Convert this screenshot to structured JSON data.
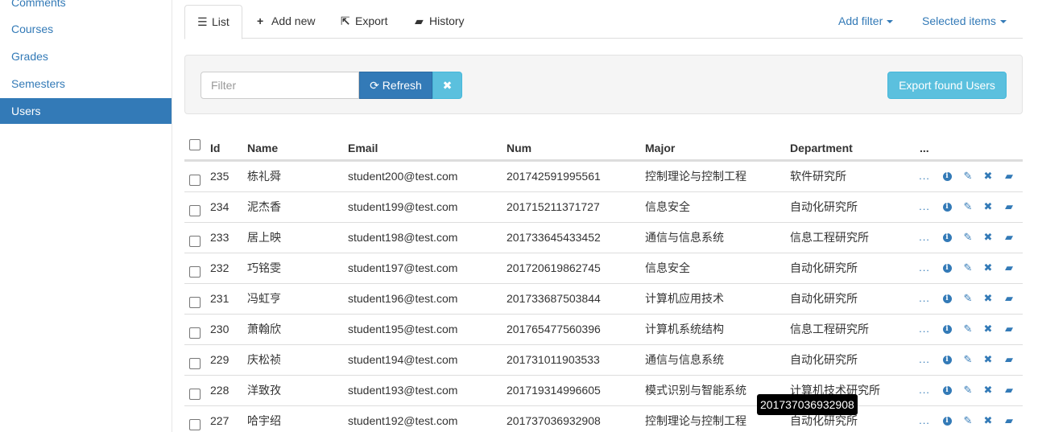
{
  "sidebar": {
    "items": [
      {
        "label": "Comments",
        "active": false
      },
      {
        "label": "Courses",
        "active": false
      },
      {
        "label": "Grades",
        "active": false
      },
      {
        "label": "Semesters",
        "active": false
      },
      {
        "label": "Users",
        "active": true
      }
    ]
  },
  "tabs": {
    "list": "List",
    "add_new": "Add new",
    "export": "Export",
    "history": "History",
    "add_filter": "Add filter",
    "selected_items": "Selected items"
  },
  "filter": {
    "placeholder": "Filter",
    "value": "",
    "refresh_label": "Refresh",
    "clear_label": "✖",
    "export_found_label": "Export found Users"
  },
  "table": {
    "headers": {
      "id": "Id",
      "name": "Name",
      "email": "Email",
      "num": "Num",
      "major": "Major",
      "department": "Department",
      "more": "..."
    },
    "rows": [
      {
        "id": "235",
        "name": "栋礼舜",
        "email": "student200@test.com",
        "num": "201742591995561",
        "major": "控制理论与控制工程",
        "department": "软件研究所"
      },
      {
        "id": "234",
        "name": "泥杰香",
        "email": "student199@test.com",
        "num": "201715211371727",
        "major": "信息安全",
        "department": "自动化研究所"
      },
      {
        "id": "233",
        "name": "居上映",
        "email": "student198@test.com",
        "num": "201733645433452",
        "major": "通信与信息系统",
        "department": "信息工程研究所"
      },
      {
        "id": "232",
        "name": "巧铭雯",
        "email": "student197@test.com",
        "num": "201720619862745",
        "major": "信息安全",
        "department": "自动化研究所"
      },
      {
        "id": "231",
        "name": "冯虹亨",
        "email": "student196@test.com",
        "num": "201733687503844",
        "major": "计算机应用技术",
        "department": "自动化研究所"
      },
      {
        "id": "230",
        "name": "萧翰欣",
        "email": "student195@test.com",
        "num": "201765477560396",
        "major": "计算机系统结构",
        "department": "信息工程研究所"
      },
      {
        "id": "229",
        "name": "庆松祯",
        "email": "student194@test.com",
        "num": "201731011903533",
        "major": "通信与信息系统",
        "department": "自动化研究所"
      },
      {
        "id": "228",
        "name": "洋致孜",
        "email": "student193@test.com",
        "num": "201719314996605",
        "major": "模式识别与智能系统",
        "department": "计算机技术研究所"
      },
      {
        "id": "227",
        "name": "哈宇绍",
        "email": "student192@test.com",
        "num": "201737036932908",
        "major": "控制理论与控制工程",
        "department": "自动化研究所"
      }
    ],
    "row_action_more": "..."
  },
  "tooltip": {
    "text": "201737036932908"
  },
  "colors": {
    "primary": "#337ab7",
    "info": "#5bc0de",
    "well": "#f5f5f5",
    "border": "#dddddd"
  }
}
